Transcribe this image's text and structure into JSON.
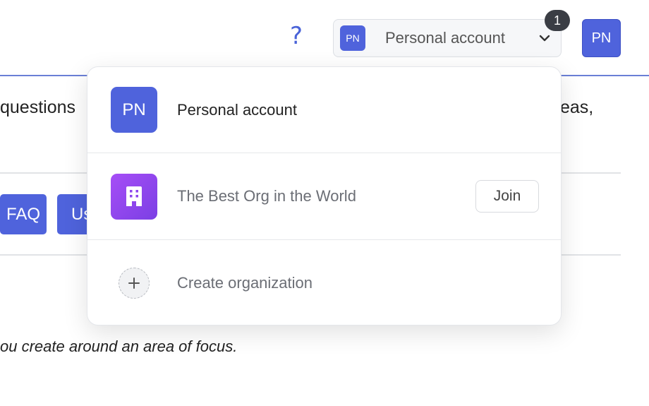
{
  "header": {
    "help_glyph": "?",
    "switcher": {
      "avatar_initials": "PN",
      "label": "Personal account"
    },
    "notification_count": "1",
    "user_avatar_initials": "PN"
  },
  "background": {
    "text_line_1_left": "questions",
    "text_line_1_right": "eas,",
    "buttons": [
      {
        "label": "FAQ"
      },
      {
        "label": "Us"
      }
    ],
    "italic_text": "ou create around an area of focus."
  },
  "dropdown": {
    "items": [
      {
        "avatar_initials": "PN",
        "label": "Personal account"
      },
      {
        "icon": "building-icon",
        "label": "The Best Org in the World",
        "action_label": "Join"
      },
      {
        "icon": "plus-icon",
        "label": "Create organization"
      }
    ]
  },
  "colors": {
    "accent": "#4f63dc",
    "org_gradient_start": "#a64ef6",
    "org_gradient_end": "#7b3fe4",
    "badge": "#3a3d44"
  }
}
